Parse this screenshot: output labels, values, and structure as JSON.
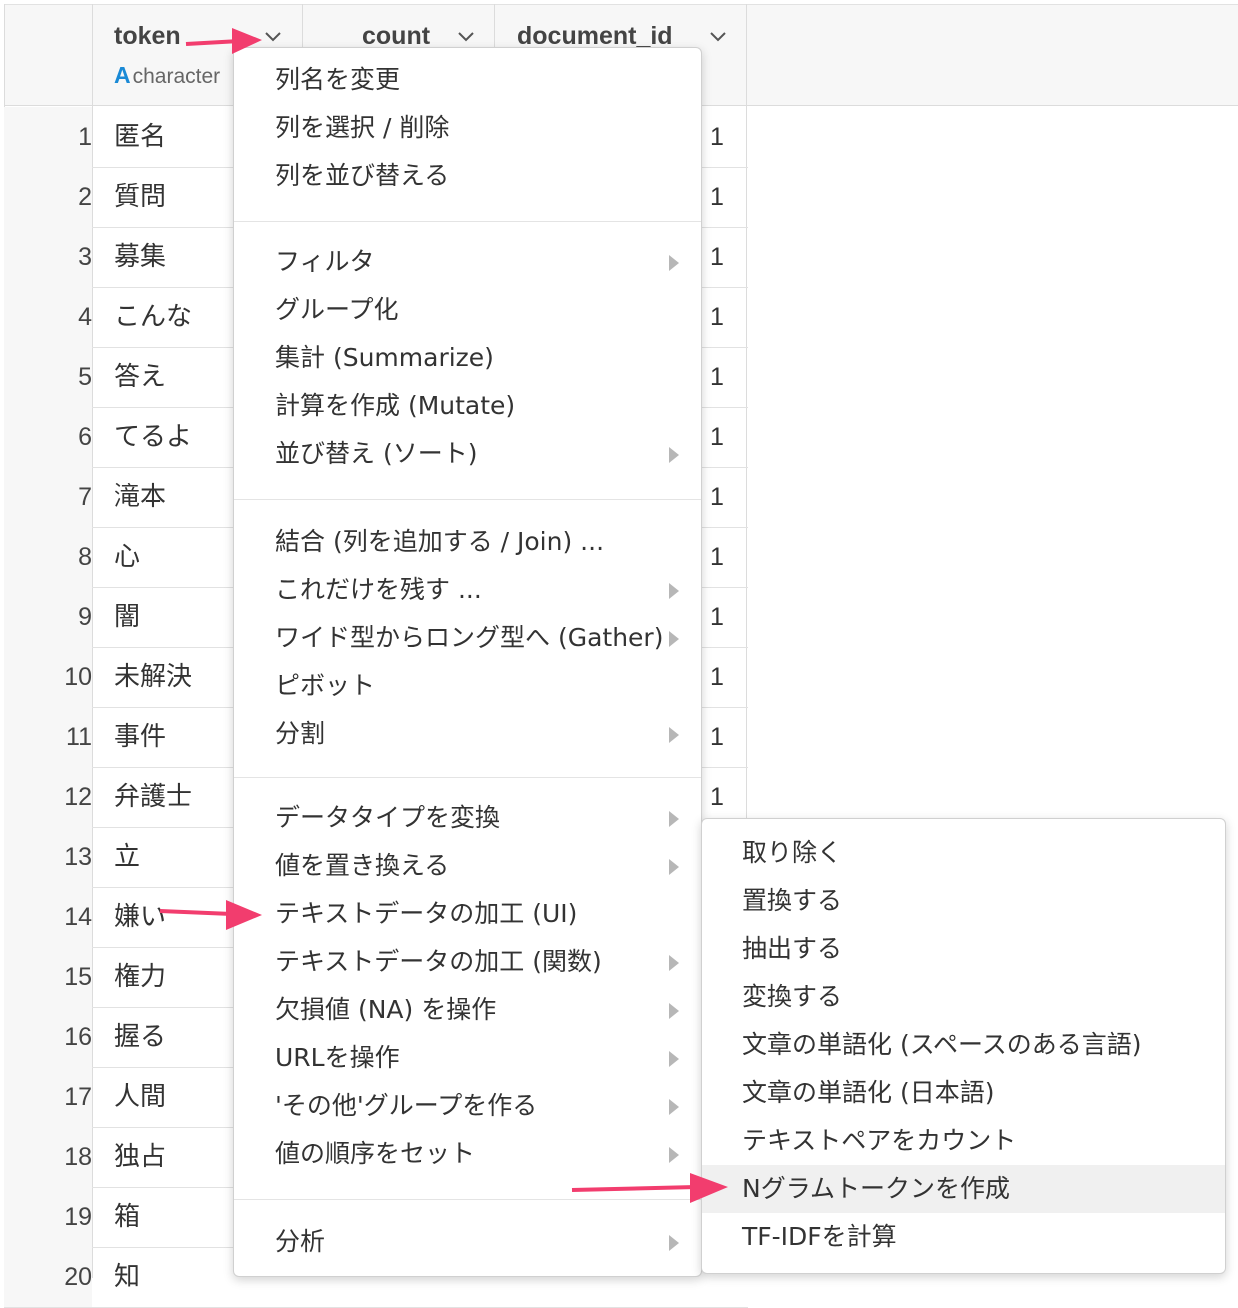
{
  "columns": [
    {
      "name": "token",
      "type_glyph": "A",
      "type_label": "character"
    },
    {
      "name": "count"
    },
    {
      "name": "document_id"
    }
  ],
  "rows": [
    {
      "n": "1",
      "token": "匿名",
      "doc": "1"
    },
    {
      "n": "2",
      "token": "質問",
      "doc": "1"
    },
    {
      "n": "3",
      "token": "募集",
      "doc": "1"
    },
    {
      "n": "4",
      "token": "こんな",
      "doc": "1"
    },
    {
      "n": "5",
      "token": "答え",
      "doc": "1"
    },
    {
      "n": "6",
      "token": "てるよ",
      "doc": "1"
    },
    {
      "n": "7",
      "token": "滝本",
      "doc": "1"
    },
    {
      "n": "8",
      "token": "心",
      "doc": "1"
    },
    {
      "n": "9",
      "token": "闇",
      "doc": "1"
    },
    {
      "n": "10",
      "token": "未解決",
      "doc": "1"
    },
    {
      "n": "11",
      "token": "事件",
      "doc": "1"
    },
    {
      "n": "12",
      "token": "弁護士",
      "doc": "1"
    },
    {
      "n": "13",
      "token": "立",
      "doc": ""
    },
    {
      "n": "14",
      "token": "嫌い",
      "doc": ""
    },
    {
      "n": "15",
      "token": "権力",
      "doc": ""
    },
    {
      "n": "16",
      "token": "握る",
      "doc": ""
    },
    {
      "n": "17",
      "token": "人間",
      "doc": ""
    },
    {
      "n": "18",
      "token": "独占",
      "doc": ""
    },
    {
      "n": "19",
      "token": "箱",
      "doc": ""
    },
    {
      "n": "20",
      "token": "知",
      "doc": ""
    }
  ],
  "menu": {
    "groups": [
      [
        {
          "label": "列名を変更",
          "submenu": false
        },
        {
          "label": "列を選択 / 削除",
          "submenu": false
        },
        {
          "label": "列を並び替える",
          "submenu": false
        }
      ],
      [
        {
          "label": "フィルタ",
          "submenu": true
        },
        {
          "label": "グループ化",
          "submenu": false
        },
        {
          "label": "集計 (Summarize)",
          "submenu": false
        },
        {
          "label": "計算を作成 (Mutate)",
          "submenu": false
        },
        {
          "label": "並び替え (ソート)",
          "submenu": true
        }
      ],
      [
        {
          "label": "結合 (列を追加する / Join) ...",
          "submenu": false
        },
        {
          "label": "これだけを残す ...",
          "submenu": true
        },
        {
          "label": "ワイド型からロング型へ (Gather)",
          "submenu": true
        },
        {
          "label": "ピボット",
          "submenu": false
        },
        {
          "label": "分割",
          "submenu": true
        }
      ],
      [
        {
          "label": "データタイプを変換",
          "submenu": true
        },
        {
          "label": "値を置き換える",
          "submenu": true
        },
        {
          "label": "テキストデータの加工 (UI)",
          "submenu": false
        },
        {
          "label": "テキストデータの加工 (関数)",
          "submenu": true
        },
        {
          "label": "欠損値 (NA) を操作",
          "submenu": true
        },
        {
          "label": "URLを操作",
          "submenu": true
        },
        {
          "label": "'その他'グループを作る",
          "submenu": true
        },
        {
          "label": "値の順序をセット",
          "submenu": true
        }
      ],
      [
        {
          "label": "分析",
          "submenu": true
        }
      ]
    ]
  },
  "submenu": {
    "items": [
      "取り除く",
      "置換する",
      "抽出する",
      "変換する",
      "文章の単語化 (スペースのある言語)",
      "文章の単語化 (日本語)",
      "テキストペアをカウント",
      "Nグラムトークンを作成",
      "TF-IDFを計算"
    ],
    "highlighted_index": 7
  },
  "colors": {
    "annotation_arrow": "#f23d6e",
    "type_glyph": "#1a8ad6"
  }
}
